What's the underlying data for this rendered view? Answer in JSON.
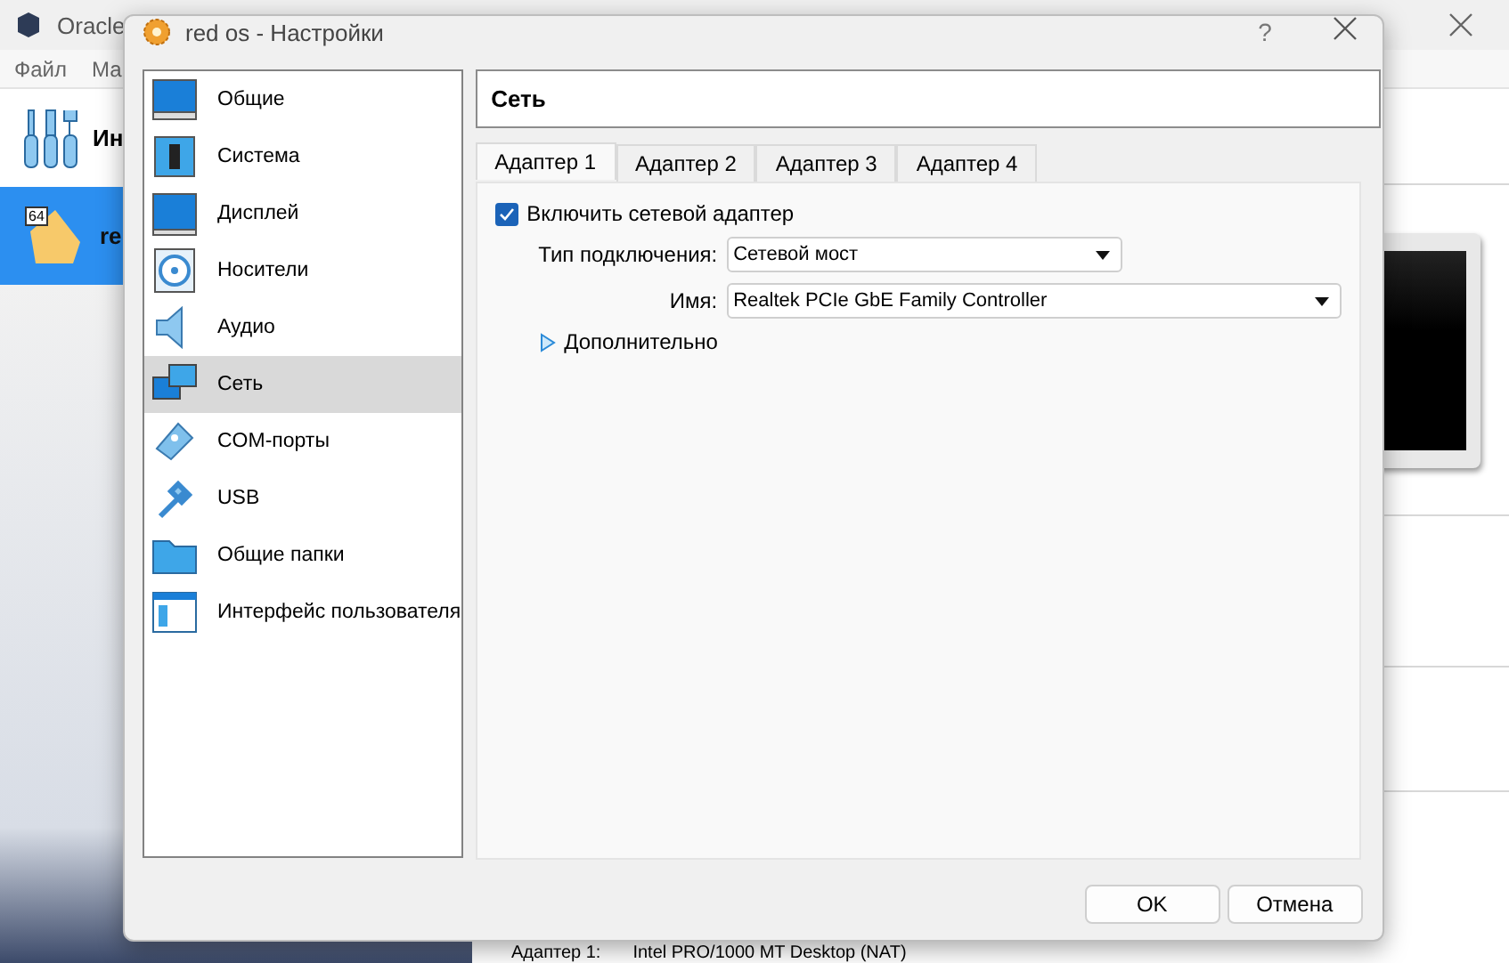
{
  "main_window": {
    "title": "Oracle",
    "menu": [
      "Файл",
      "Ма"
    ],
    "tools_label": "Ин",
    "vm": {
      "name": "re",
      "badge": "64",
      "selected": true
    },
    "details": [
      {
        "label": "Адаптер 1:",
        "value": "Intel PRO/1000 MT Desktop (NAT)"
      }
    ]
  },
  "dialog": {
    "title": "red os - Настройки",
    "help": "?",
    "sidebar": {
      "items": [
        {
          "label": "Общие",
          "selected": false
        },
        {
          "label": "Система",
          "selected": false
        },
        {
          "label": "Дисплей",
          "selected": false
        },
        {
          "label": "Носители",
          "selected": false
        },
        {
          "label": "Аудио",
          "selected": false
        },
        {
          "label": "Сеть",
          "selected": true
        },
        {
          "label": "COM-порты",
          "selected": false
        },
        {
          "label": "USB",
          "selected": false
        },
        {
          "label": "Общие папки",
          "selected": false
        },
        {
          "label": "Интерфейс пользователя",
          "selected": false
        }
      ]
    },
    "page_title": "Сеть",
    "tabs": [
      {
        "label": "Адаптер 1",
        "selected": true
      },
      {
        "label": "Адаптер 2",
        "selected": false
      },
      {
        "label": "Адаптер 3",
        "selected": false
      },
      {
        "label": "Адаптер 4",
        "selected": false
      }
    ],
    "enable_adapter": {
      "label": "Включить сетевой адаптер",
      "checked": true
    },
    "fields": [
      {
        "label": "Тип подключения:",
        "value": "Сетевой мост",
        "wide": false
      },
      {
        "label": "Имя:",
        "value": "Realtek PCIe GbE Family Controller",
        "wide": true
      }
    ],
    "advanced": {
      "label": "Дополнительно",
      "expanded": false
    },
    "buttons": [
      "OK",
      "Отмена"
    ]
  }
}
